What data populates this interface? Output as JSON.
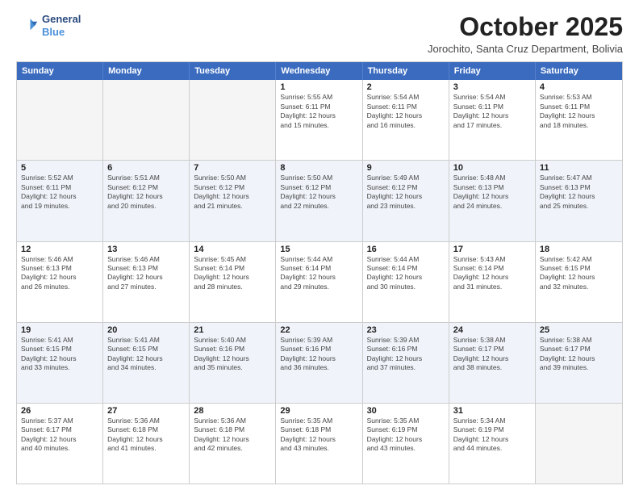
{
  "header": {
    "logo_line1": "General",
    "logo_line2": "Blue",
    "month": "October 2025",
    "location": "Jorochito, Santa Cruz Department, Bolivia"
  },
  "days_of_week": [
    "Sunday",
    "Monday",
    "Tuesday",
    "Wednesday",
    "Thursday",
    "Friday",
    "Saturday"
  ],
  "rows": [
    [
      {
        "day": "",
        "info": ""
      },
      {
        "day": "",
        "info": ""
      },
      {
        "day": "",
        "info": ""
      },
      {
        "day": "1",
        "info": "Sunrise: 5:55 AM\nSunset: 6:11 PM\nDaylight: 12 hours\nand 15 minutes."
      },
      {
        "day": "2",
        "info": "Sunrise: 5:54 AM\nSunset: 6:11 PM\nDaylight: 12 hours\nand 16 minutes."
      },
      {
        "day": "3",
        "info": "Sunrise: 5:54 AM\nSunset: 6:11 PM\nDaylight: 12 hours\nand 17 minutes."
      },
      {
        "day": "4",
        "info": "Sunrise: 5:53 AM\nSunset: 6:11 PM\nDaylight: 12 hours\nand 18 minutes."
      }
    ],
    [
      {
        "day": "5",
        "info": "Sunrise: 5:52 AM\nSunset: 6:11 PM\nDaylight: 12 hours\nand 19 minutes."
      },
      {
        "day": "6",
        "info": "Sunrise: 5:51 AM\nSunset: 6:12 PM\nDaylight: 12 hours\nand 20 minutes."
      },
      {
        "day": "7",
        "info": "Sunrise: 5:50 AM\nSunset: 6:12 PM\nDaylight: 12 hours\nand 21 minutes."
      },
      {
        "day": "8",
        "info": "Sunrise: 5:50 AM\nSunset: 6:12 PM\nDaylight: 12 hours\nand 22 minutes."
      },
      {
        "day": "9",
        "info": "Sunrise: 5:49 AM\nSunset: 6:12 PM\nDaylight: 12 hours\nand 23 minutes."
      },
      {
        "day": "10",
        "info": "Sunrise: 5:48 AM\nSunset: 6:13 PM\nDaylight: 12 hours\nand 24 minutes."
      },
      {
        "day": "11",
        "info": "Sunrise: 5:47 AM\nSunset: 6:13 PM\nDaylight: 12 hours\nand 25 minutes."
      }
    ],
    [
      {
        "day": "12",
        "info": "Sunrise: 5:46 AM\nSunset: 6:13 PM\nDaylight: 12 hours\nand 26 minutes."
      },
      {
        "day": "13",
        "info": "Sunrise: 5:46 AM\nSunset: 6:13 PM\nDaylight: 12 hours\nand 27 minutes."
      },
      {
        "day": "14",
        "info": "Sunrise: 5:45 AM\nSunset: 6:14 PM\nDaylight: 12 hours\nand 28 minutes."
      },
      {
        "day": "15",
        "info": "Sunrise: 5:44 AM\nSunset: 6:14 PM\nDaylight: 12 hours\nand 29 minutes."
      },
      {
        "day": "16",
        "info": "Sunrise: 5:44 AM\nSunset: 6:14 PM\nDaylight: 12 hours\nand 30 minutes."
      },
      {
        "day": "17",
        "info": "Sunrise: 5:43 AM\nSunset: 6:14 PM\nDaylight: 12 hours\nand 31 minutes."
      },
      {
        "day": "18",
        "info": "Sunrise: 5:42 AM\nSunset: 6:15 PM\nDaylight: 12 hours\nand 32 minutes."
      }
    ],
    [
      {
        "day": "19",
        "info": "Sunrise: 5:41 AM\nSunset: 6:15 PM\nDaylight: 12 hours\nand 33 minutes."
      },
      {
        "day": "20",
        "info": "Sunrise: 5:41 AM\nSunset: 6:15 PM\nDaylight: 12 hours\nand 34 minutes."
      },
      {
        "day": "21",
        "info": "Sunrise: 5:40 AM\nSunset: 6:16 PM\nDaylight: 12 hours\nand 35 minutes."
      },
      {
        "day": "22",
        "info": "Sunrise: 5:39 AM\nSunset: 6:16 PM\nDaylight: 12 hours\nand 36 minutes."
      },
      {
        "day": "23",
        "info": "Sunrise: 5:39 AM\nSunset: 6:16 PM\nDaylight: 12 hours\nand 37 minutes."
      },
      {
        "day": "24",
        "info": "Sunrise: 5:38 AM\nSunset: 6:17 PM\nDaylight: 12 hours\nand 38 minutes."
      },
      {
        "day": "25",
        "info": "Sunrise: 5:38 AM\nSunset: 6:17 PM\nDaylight: 12 hours\nand 39 minutes."
      }
    ],
    [
      {
        "day": "26",
        "info": "Sunrise: 5:37 AM\nSunset: 6:17 PM\nDaylight: 12 hours\nand 40 minutes."
      },
      {
        "day": "27",
        "info": "Sunrise: 5:36 AM\nSunset: 6:18 PM\nDaylight: 12 hours\nand 41 minutes."
      },
      {
        "day": "28",
        "info": "Sunrise: 5:36 AM\nSunset: 6:18 PM\nDaylight: 12 hours\nand 42 minutes."
      },
      {
        "day": "29",
        "info": "Sunrise: 5:35 AM\nSunset: 6:18 PM\nDaylight: 12 hours\nand 43 minutes."
      },
      {
        "day": "30",
        "info": "Sunrise: 5:35 AM\nSunset: 6:19 PM\nDaylight: 12 hours\nand 43 minutes."
      },
      {
        "day": "31",
        "info": "Sunrise: 5:34 AM\nSunset: 6:19 PM\nDaylight: 12 hours\nand 44 minutes."
      },
      {
        "day": "",
        "info": ""
      }
    ]
  ]
}
